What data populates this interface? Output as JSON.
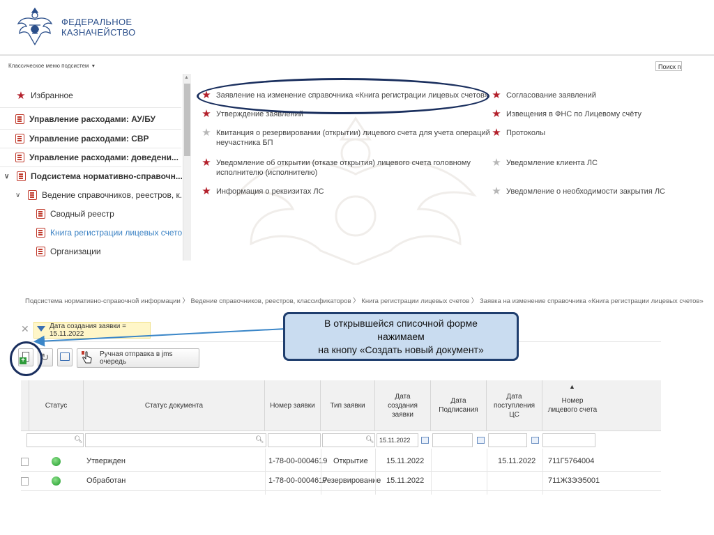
{
  "header": {
    "org_line1": "ФЕДЕРАЛЬНОЕ",
    "org_line2": "КАЗНАЧЕЙСТВО"
  },
  "top_bar": {
    "classic_menu": "Классическое меню подсистем",
    "search_placeholder": "Поиск п"
  },
  "left_menu": {
    "favorites": "Избранное",
    "items": [
      {
        "label": "Управление расходами: АУ/БУ"
      },
      {
        "label": "Управление расходами: СВР"
      },
      {
        "label": "Управление расходами: доведени..."
      },
      {
        "label": "Подсистема нормативно-справочн..."
      },
      {
        "label": "Ведение справочников, реестров, к..."
      },
      {
        "label": "Сводный реестр"
      },
      {
        "label": "Книга регистрации лицевых счетов"
      },
      {
        "label": "Организации"
      }
    ]
  },
  "center_items": [
    {
      "label": "Заявление на изменение справочника «Книга регистрации лицевых счетов»",
      "starred": true
    },
    {
      "label": "Утверждение заявлений",
      "starred": true
    },
    {
      "label": "Квитанция о резервировании (открытии) лицевого счета для учета операций",
      "label2": "неучастника БП",
      "starred": false
    },
    {
      "label": "Уведомление об открытии (отказе открытия) лицевого счета головному",
      "label2": "исполнителю (исполнителю)",
      "starred": true
    },
    {
      "label": "Информация о реквизитах ЛС",
      "starred": true
    }
  ],
  "right_items": [
    {
      "label": "Согласование заявлений",
      "starred": true
    },
    {
      "label": "Извещения в ФНС по Лицевому счёту",
      "starred": true
    },
    {
      "label": "Протоколы",
      "starred": true
    },
    {
      "label": "Уведомление клиента ЛС",
      "starred": false
    },
    {
      "label": "Уведомление о необходимости закрытия ЛС",
      "starred": false
    }
  ],
  "breadcrumb": "Подсистема нормативно-справочной информации  〉 Ведение справочников, реестров, классификаторов  〉 Книга регистрации лицевых счетов  〉 Заявка на изменение справочника «Книга регистрации лицевых счетов»",
  "filter": {
    "chip": "Дата создания заявки = 15.11.2022"
  },
  "toolbar": {
    "send_label": "Ручная отправка в jms очередь"
  },
  "callout": {
    "line1": "В открывшейся списочной форме",
    "line2": "нажимаем",
    "line3": "на кнопу «Создать новый документ»"
  },
  "table": {
    "headers": {
      "status": "Статус",
      "doc_status": "Статус документа",
      "request_no": "Номер заявки",
      "request_type": "Тип заявки",
      "created": "Дата создания заявки",
      "signed": "Дата Подписания",
      "received": "Дата поступления ЦС",
      "account": "Номер лицевого счета"
    },
    "filter_date": "15.11.2022",
    "rows": [
      {
        "doc_status": "Утвержден",
        "request_no": "1-78-00-0004619",
        "request_type": "Открытие",
        "created": "15.11.2022",
        "signed": "",
        "received": "15.11.2022",
        "account": "711Г5764004"
      },
      {
        "doc_status": "Обработан",
        "request_no": "1-78-00-0004617",
        "request_type": "Резервирование",
        "created": "15.11.2022",
        "signed": "",
        "received": "",
        "account": "711Ж3ЭЭ5001"
      }
    ]
  },
  "colors": {
    "brand": "#2a4e8a",
    "star_red": "#b3202b",
    "outline": "#1a2f5e",
    "callout_bg": "#c9dcf0"
  }
}
